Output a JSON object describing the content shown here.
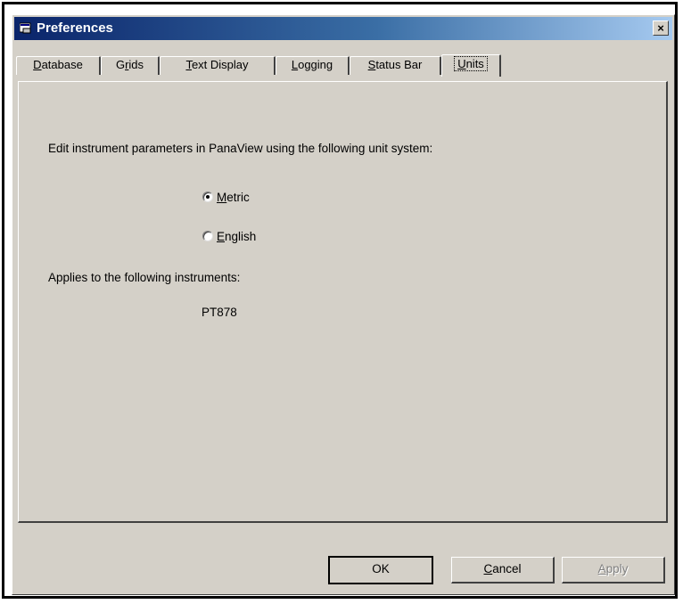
{
  "window": {
    "title": "Preferences",
    "close_symbol": "×"
  },
  "tabs": [
    {
      "pre": "",
      "key": "D",
      "post": "atabase"
    },
    {
      "pre": "G",
      "key": "r",
      "post": "ids"
    },
    {
      "pre": "",
      "key": "T",
      "post": "ext Display"
    },
    {
      "pre": "",
      "key": "L",
      "post": "ogging"
    },
    {
      "pre": "",
      "key": "S",
      "post": "tatus Bar"
    },
    {
      "pre": "",
      "key": "U",
      "post": "nits"
    }
  ],
  "active_tab_index": 5,
  "units_panel": {
    "instruction": "Edit instrument parameters in PanaView using the following unit system:",
    "options": [
      {
        "key": "M",
        "rest": "etric",
        "checked": true
      },
      {
        "key": "E",
        "rest": "nglish",
        "checked": false
      }
    ],
    "applies_label": "Applies to the following instruments:",
    "instruments": [
      "PT878"
    ]
  },
  "buttons": {
    "ok": {
      "label": "OK"
    },
    "cancel": {
      "key": "C",
      "rest": "ancel"
    },
    "apply": {
      "key": "A",
      "rest": "pply",
      "enabled": false
    }
  },
  "colors": {
    "titlebar_start": "#0a246a",
    "titlebar_end": "#a6caf0",
    "face": "#d4d0c8"
  },
  "icons": {
    "title_icon": "preferences-app-icon",
    "close": "close-icon"
  }
}
